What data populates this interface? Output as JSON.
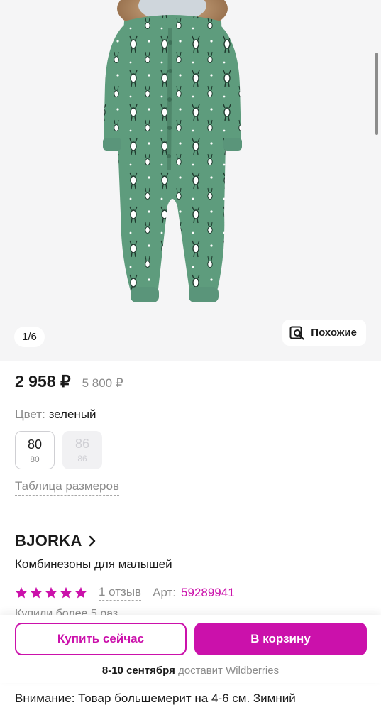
{
  "gallery": {
    "counter": "1/6",
    "similar_label": "Похожие"
  },
  "product": {
    "price": "2 958 ₽",
    "old_price": "5 800 ₽",
    "color_label": "Цвет:",
    "color_value": "зеленый",
    "sizes": [
      {
        "main": "80",
        "sub": "80",
        "available": true,
        "selected": true
      },
      {
        "main": "86",
        "sub": "86",
        "available": false,
        "selected": false
      }
    ],
    "size_table_link": "Таблица размеров",
    "brand": "BJORKA",
    "category": "Комбинезоны для малышей",
    "rating_stars": 5,
    "reviews_link": "1 отзыв",
    "article_label": "Арт:",
    "article_value": "59289941",
    "bought": "Купили более 5 раз"
  },
  "actions": {
    "buy_now": "Купить сейчас",
    "add_to_cart": "В корзину",
    "delivery_date": "8-10 сентября",
    "delivery_by": "доставит Wildberries"
  },
  "notice": "Внимание: Товар большемерит на 4-6 см. Зимний",
  "colors": {
    "accent": "#cb11ab",
    "suit_green": "#5e9c7d",
    "muted_text": "#8b8b8b"
  }
}
